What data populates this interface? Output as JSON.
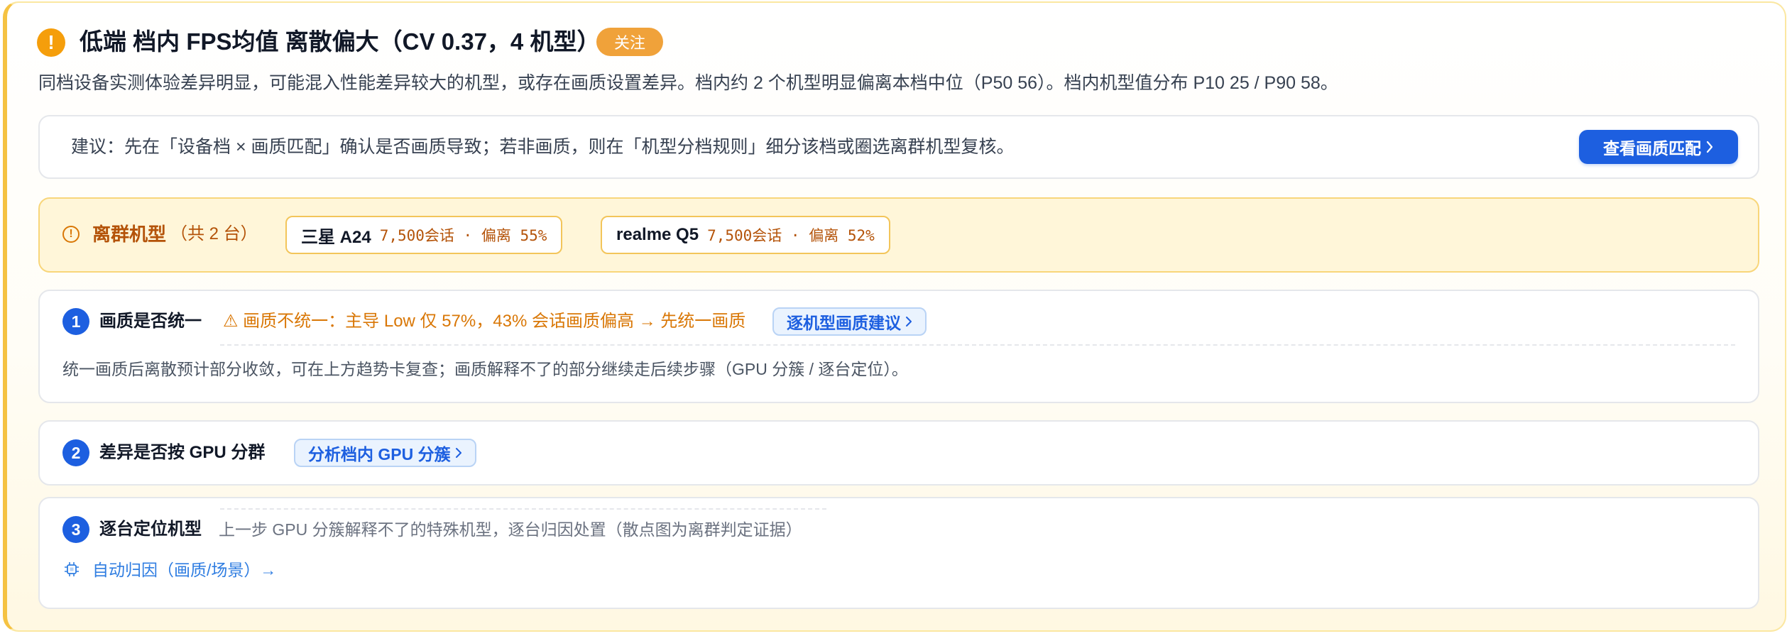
{
  "header": {
    "icon": "exclamation-circle-icon",
    "title": "低端 档内 FPS均值 离散偏大（CV 0.37，4 机型）",
    "badge": "关注",
    "subtitle": "同档设备实测体验差异明显，可能混入性能差异较大的机型，或存在画质设置差异。档内约 2 个机型明显偏离本档中位（P50 56）。档内机型值分布 P10 25 / P90 58。"
  },
  "suggestion": {
    "text": "建议：先在「设备档 × 画质匹配」确认是否画质导致；若非画质，则在「机型分档规则」细分该档或圈选离群机型复核。",
    "button_label": "查看画质匹配",
    "button_icon": "chevron-right-icon"
  },
  "outliers": {
    "icon": "info-circle-icon",
    "label": "离群机型",
    "count_text": "（共 2 台）",
    "items": [
      {
        "name": "三星 A24",
        "meta": "7,500会话 · 偏离 55%"
      },
      {
        "name": "realme Q5",
        "meta": "7,500会话 · 偏离 52%"
      }
    ]
  },
  "steps": [
    {
      "number": "1",
      "title": "画质是否统一",
      "warning": "⚠ 画质不统一：主导 Low 仅 57%，43% 会话画质偏高 → 先统一画质",
      "link_label": "逐机型画质建议",
      "note": "统一画质后离散预计部分收敛，可在上方趋势卡复查；画质解释不了的部分继续走后续步骤（GPU 分簇 / 逐台定位）。"
    },
    {
      "number": "2",
      "title": "差异是否按 GPU 分群",
      "link_label": "分析档内 GPU 分簇"
    },
    {
      "number": "3",
      "title": "逐台定位机型",
      "description": "上一步 GPU 分簇解释不了的特殊机型，逐台归因处置（散点图为离群判定证据）",
      "auto_link_icon": "chip-icon",
      "auto_link": "自动归因（画质/场景）→"
    }
  ],
  "colors": {
    "accent": "#1d5fe0",
    "warning": "#f59e0b",
    "outlier_text": "#b45309",
    "outlier_bg": "#fff6d9"
  }
}
